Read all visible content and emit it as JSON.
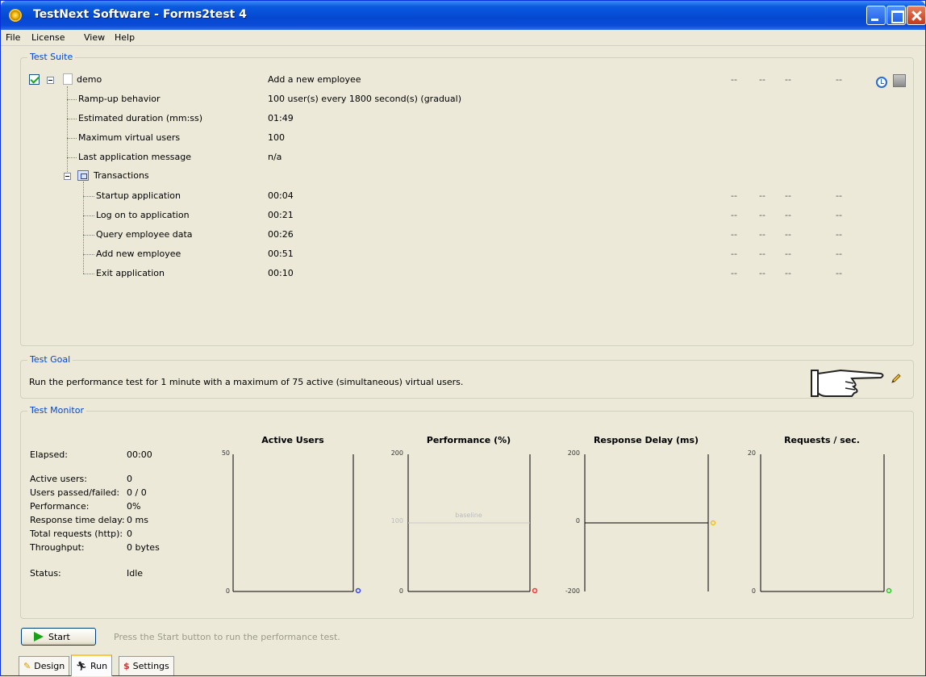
{
  "window": {
    "title": "TestNext Software - Forms2test 4"
  },
  "menu": [
    "File",
    "License",
    "View",
    "Help"
  ],
  "suite": {
    "label": "Test Suite",
    "root": {
      "name": "demo",
      "description": "Add a new employee",
      "dashes": [
        "--",
        "--",
        "--",
        "--"
      ]
    },
    "properties": [
      {
        "label": "Ramp-up behavior",
        "value": "100 user(s) every 1800 second(s) (gradual)"
      },
      {
        "label": "Estimated duration (mm:ss)",
        "value": "01:49"
      },
      {
        "label": "Maximum virtual users",
        "value": "100"
      },
      {
        "label": "Last application message",
        "value": "n/a"
      }
    ],
    "transactions_label": "Transactions",
    "transactions": [
      {
        "name": "Startup application",
        "time": "00:04",
        "dashes": [
          "--",
          "--",
          "--",
          "--"
        ]
      },
      {
        "name": "Log on to application",
        "time": "00:21",
        "dashes": [
          "--",
          "--",
          "--",
          "--"
        ]
      },
      {
        "name": "Query employee data",
        "time": "00:26",
        "dashes": [
          "--",
          "--",
          "--",
          "--"
        ]
      },
      {
        "name": "Add new employee",
        "time": "00:51",
        "dashes": [
          "--",
          "--",
          "--",
          "--"
        ]
      },
      {
        "name": "Exit application",
        "time": "00:10",
        "dashes": [
          "--",
          "--",
          "--",
          "--"
        ]
      }
    ]
  },
  "goal": {
    "label": "Test Goal",
    "text": "Run the performance test for 1 minute with a maximum of 75 active (simultaneous) virtual users."
  },
  "monitor": {
    "label": "Test Monitor",
    "stats": [
      {
        "label": "Elapsed:",
        "value": "00:00"
      },
      {
        "label": "Active users:",
        "value": "0"
      },
      {
        "label": "Users passed/failed:",
        "value": "0 / 0"
      },
      {
        "label": "Performance:",
        "value": "0%"
      },
      {
        "label": "Response time delay:",
        "value": "0 ms"
      },
      {
        "label": "Total requests (http):",
        "value": "0"
      },
      {
        "label": "Throughput:",
        "value": "0 bytes"
      },
      {
        "label": "Status:",
        "value": "Idle"
      }
    ]
  },
  "chart_data": [
    {
      "type": "line",
      "title": "Active Users",
      "ylim": [
        0,
        50
      ],
      "yticks": [
        "50",
        "0"
      ],
      "current_value": "0",
      "series": []
    },
    {
      "type": "line",
      "title": "Performance (%)",
      "ylim": [
        0,
        200
      ],
      "yticks": [
        "200",
        "100",
        "0"
      ],
      "baseline": {
        "value": 100,
        "label": "baseline"
      },
      "current_value": "0",
      "series": []
    },
    {
      "type": "line",
      "title": "Response Delay (ms)",
      "ylim": [
        -200,
        200
      ],
      "yticks": [
        "200",
        "0",
        "-200"
      ],
      "current_value": "0",
      "series": [
        {
          "values": [
            0
          ]
        }
      ]
    },
    {
      "type": "line",
      "title": "Requests / sec.",
      "ylim": [
        0,
        20
      ],
      "yticks": [
        "20",
        "0"
      ],
      "current_value": "0",
      "series": []
    }
  ],
  "start": {
    "label": "Start",
    "hint": "Press the Start button to run the performance test."
  },
  "tabs": [
    {
      "label": "Design",
      "icon": "pencil-icon"
    },
    {
      "label": "Run",
      "icon": "runner-icon"
    },
    {
      "label": "Settings",
      "icon": "settings-icon"
    }
  ],
  "colors": {
    "title_blue": "#0a5ae0",
    "group_label": "#0046d5",
    "active_users": "#3344ff",
    "performance": "#ff3333",
    "response": "#f0c020",
    "requests": "#22cc22"
  }
}
